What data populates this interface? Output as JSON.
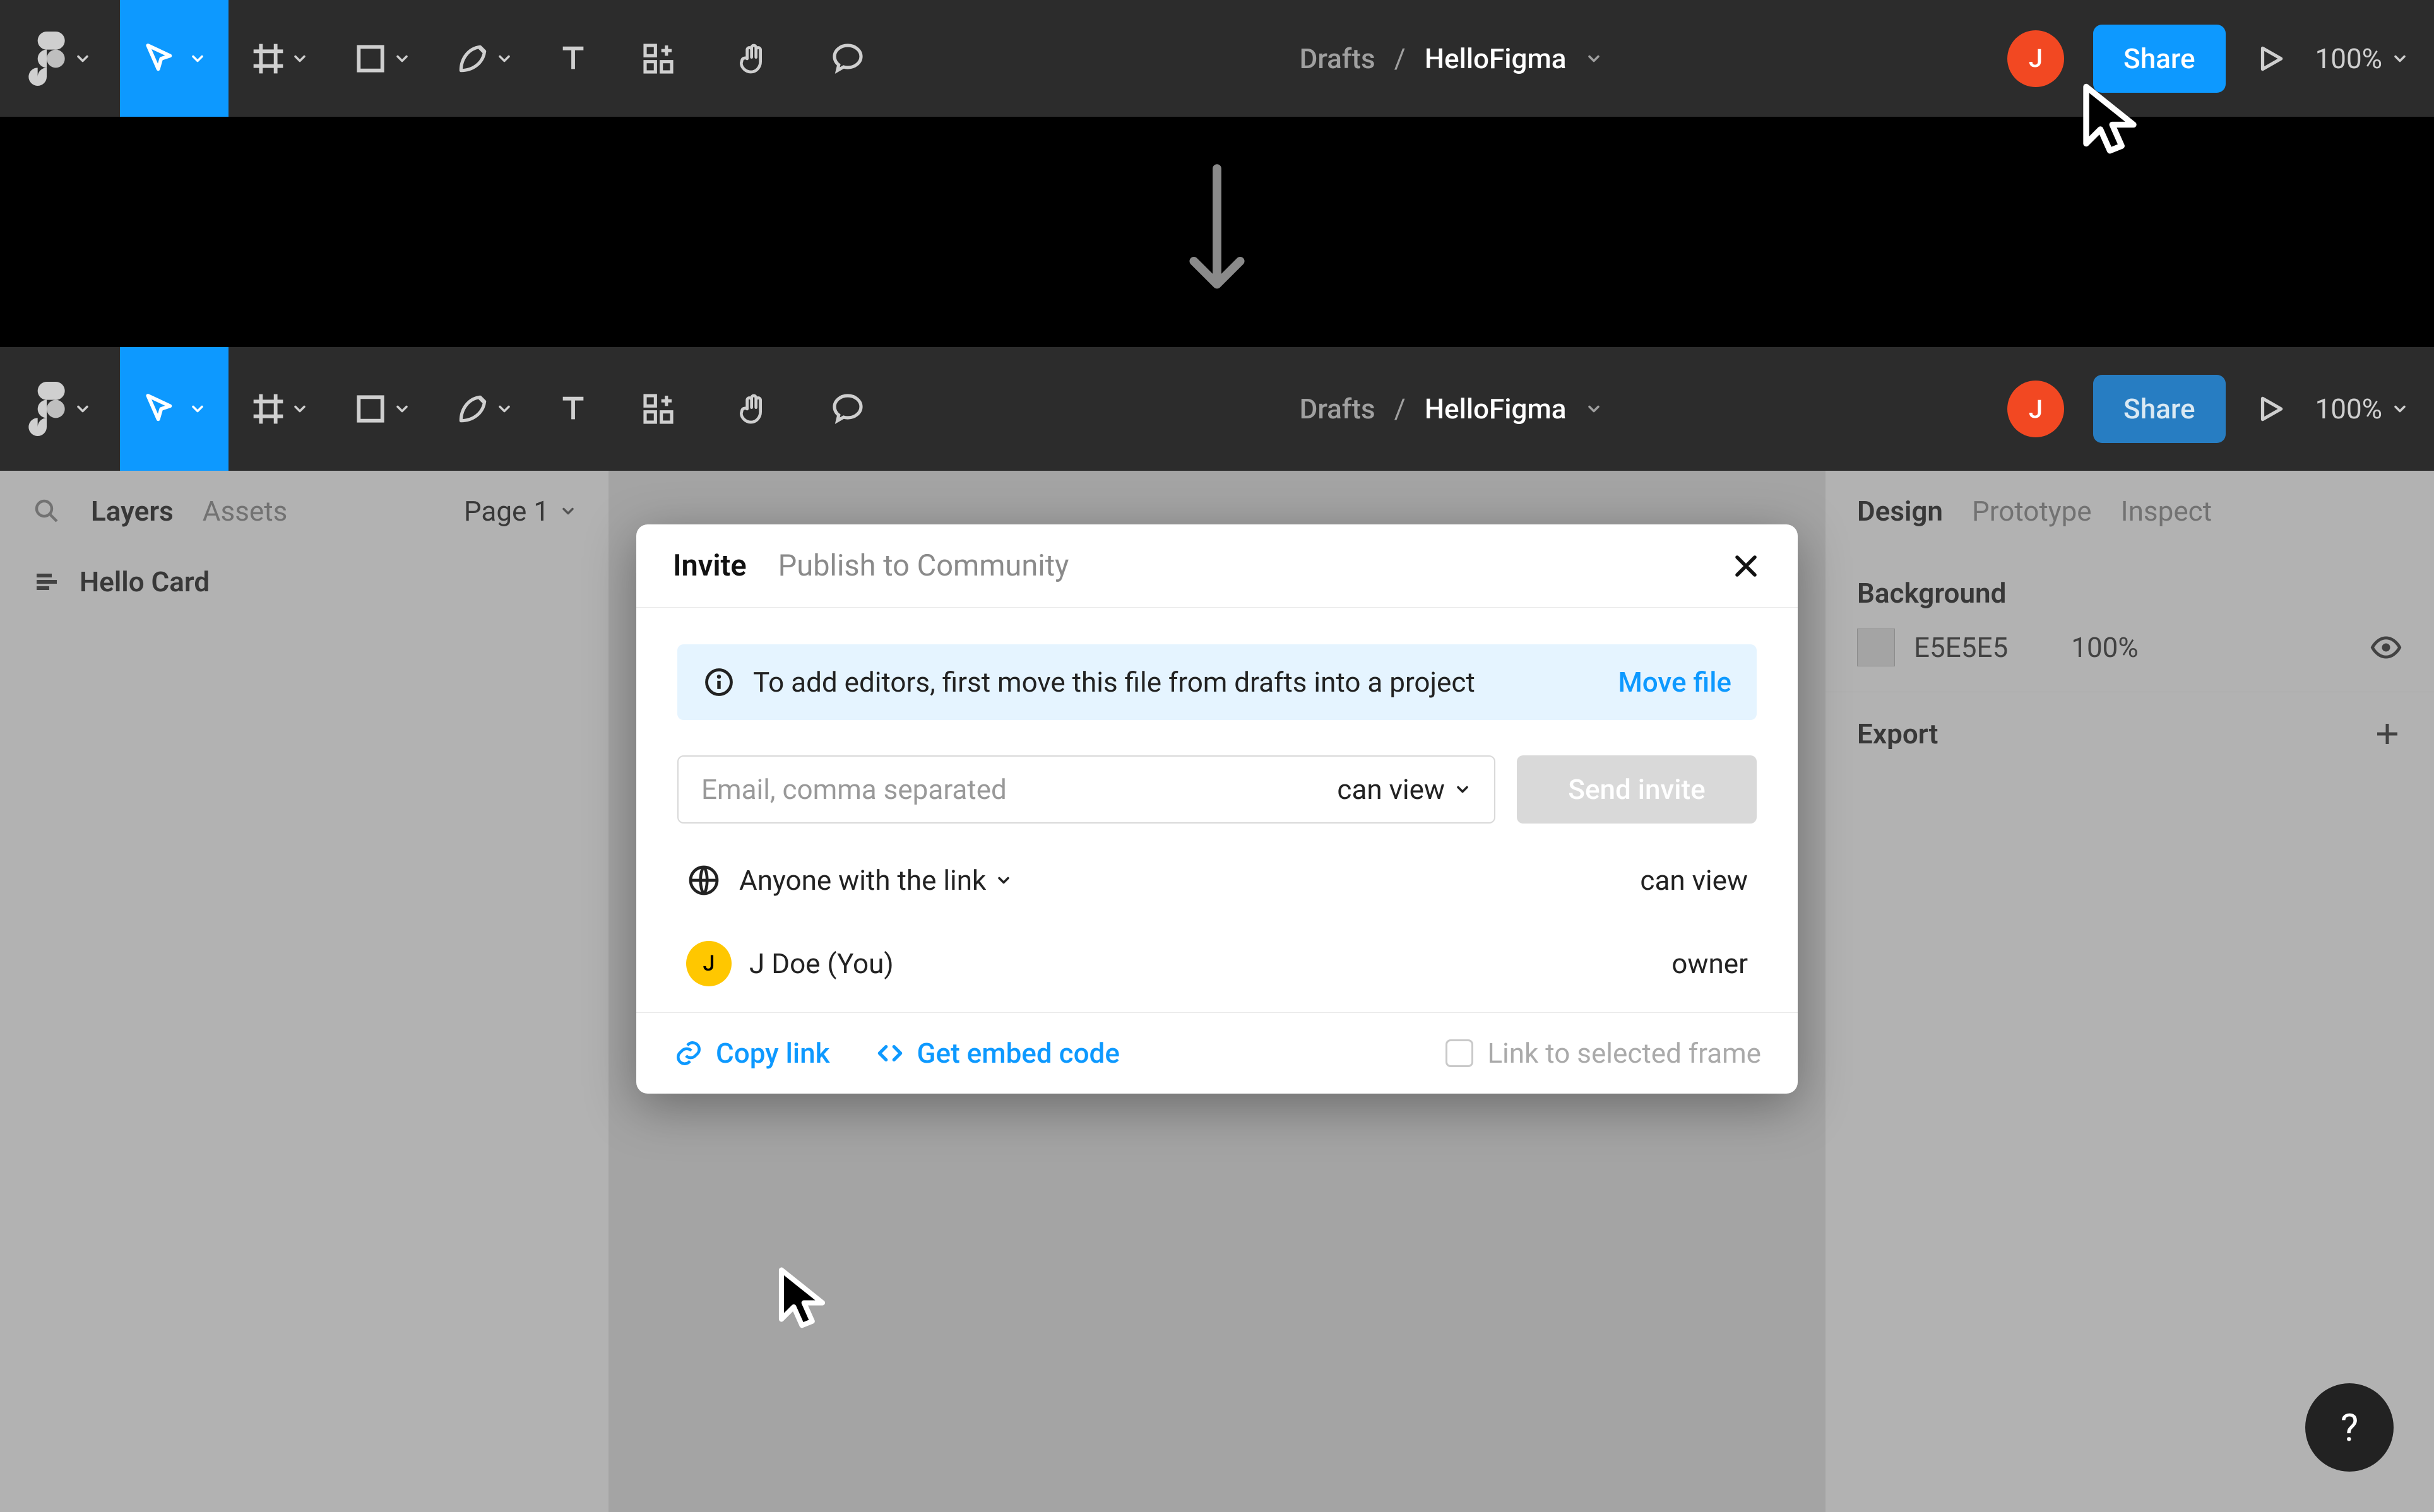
{
  "top": {
    "breadcrumb_parent": "Drafts",
    "breadcrumb_slash": "/",
    "breadcrumb_file": "HelloFigma",
    "avatar_initial": "J",
    "share_label": "Share",
    "zoom_label": "100%"
  },
  "section2": {
    "breadcrumb_parent": "Drafts",
    "breadcrumb_slash": "/",
    "breadcrumb_file": "HelloFigma",
    "avatar_initial": "J",
    "share_label": "Share",
    "zoom_label": "100%",
    "left_panel": {
      "tab_layers": "Layers",
      "tab_assets": "Assets",
      "page_label": "Page 1",
      "layer_name": "Hello Card"
    },
    "right_panel": {
      "tab_design": "Design",
      "tab_prototype": "Prototype",
      "tab_inspect": "Inspect",
      "bg_title": "Background",
      "bg_hex": "E5E5E5",
      "bg_opacity": "100%",
      "export_title": "Export"
    }
  },
  "modal": {
    "tab_invite": "Invite",
    "tab_publish": "Publish to Community",
    "hint_text": "To add editors, first move this file from drafts into a project",
    "move_file": "Move file",
    "email_placeholder": "Email, comma separated",
    "permission_select": "can view",
    "send_invite": "Send invite",
    "anyone_link": "Anyone with the link",
    "anyone_perm": "can view",
    "user_name": "J Doe (You)",
    "user_avatar_initial": "J",
    "user_role": "owner",
    "copy_link": "Copy link",
    "get_embed": "Get embed code",
    "link_selected_frame": "Link to selected frame"
  },
  "help": "?"
}
